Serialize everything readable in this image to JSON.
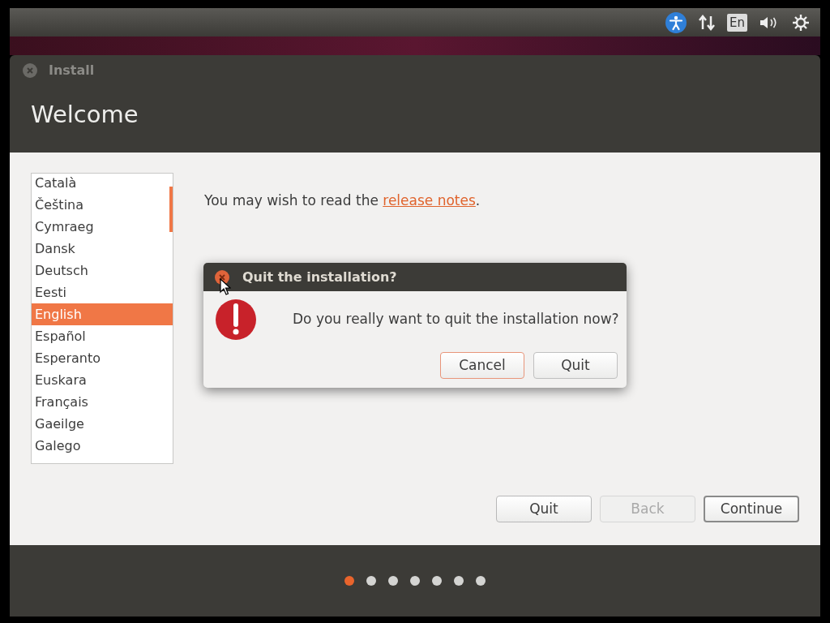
{
  "top_panel": {
    "keyboard_layout": "En"
  },
  "window": {
    "title": "Install",
    "heading": "Welcome"
  },
  "languages": [
    {
      "label": "Català",
      "selected": false
    },
    {
      "label": "Čeština",
      "selected": false
    },
    {
      "label": "Cymraeg",
      "selected": false
    },
    {
      "label": "Dansk",
      "selected": false
    },
    {
      "label": "Deutsch",
      "selected": false
    },
    {
      "label": "Eesti",
      "selected": false
    },
    {
      "label": "English",
      "selected": true
    },
    {
      "label": "Español",
      "selected": false
    },
    {
      "label": "Esperanto",
      "selected": false
    },
    {
      "label": "Euskara",
      "selected": false
    },
    {
      "label": "Français",
      "selected": false
    },
    {
      "label": "Gaeilge",
      "selected": false
    },
    {
      "label": "Galego",
      "selected": false
    }
  ],
  "release_notes": {
    "before": "You may wish to read the ",
    "link": "release notes",
    "after": "."
  },
  "buttons": [
    {
      "label": "Quit",
      "disabled": false,
      "default": false
    },
    {
      "label": "Back",
      "disabled": true,
      "default": false
    },
    {
      "label": "Continue",
      "disabled": false,
      "default": true
    }
  ],
  "dialog": {
    "title": "Quit the installation?",
    "message": "Do you really want to quit the installation now?",
    "buttons": [
      {
        "label": "Cancel",
        "focused": true
      },
      {
        "label": "Quit",
        "focused": false
      }
    ]
  },
  "steps": [
    {
      "selected": true
    },
    {
      "selected": false
    },
    {
      "selected": false
    },
    {
      "selected": false
    },
    {
      "selected": false
    },
    {
      "selected": false
    },
    {
      "selected": false
    }
  ]
}
